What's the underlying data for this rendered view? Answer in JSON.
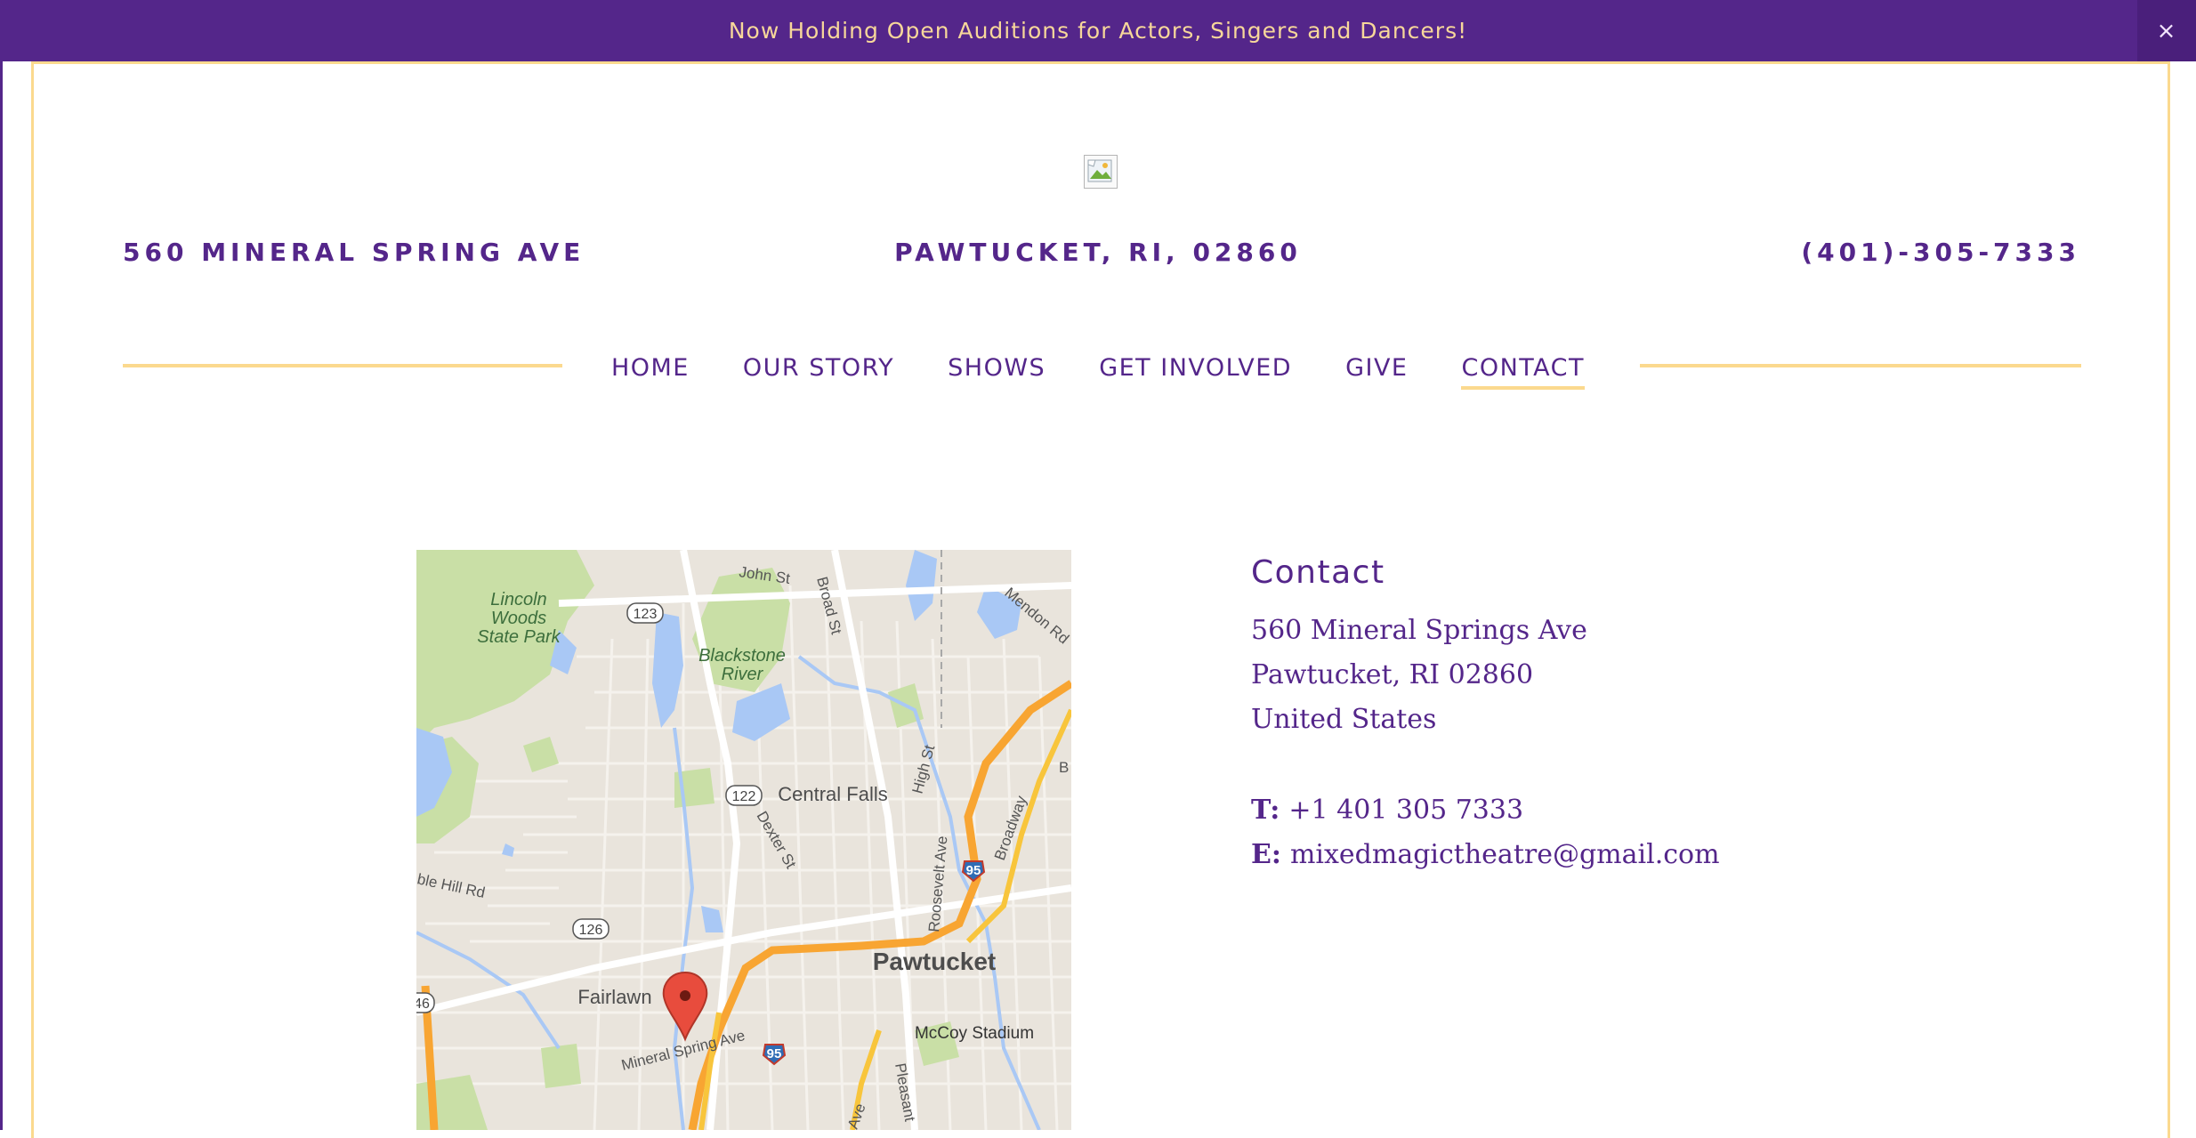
{
  "announcement": {
    "text": "Now Holding Open Auditions for Actors, Singers and Dancers!",
    "close_glyph": "×"
  },
  "header": {
    "address_street": "560 MINERAL SPRING AVE",
    "address_city": "PAWTUCKET, RI, 02860",
    "phone": "(401)-305-7333"
  },
  "nav": {
    "items": [
      {
        "label": "HOME"
      },
      {
        "label": "OUR STORY"
      },
      {
        "label": "SHOWS"
      },
      {
        "label": "GET INVOLVED"
      },
      {
        "label": "GIVE"
      },
      {
        "label": "CONTACT"
      }
    ],
    "active": "CONTACT"
  },
  "map": {
    "labels": {
      "lincoln1": "Lincoln",
      "lincoln2": "Woods",
      "lincoln3": "State Park",
      "blackstone1": "Blackstone",
      "blackstone2": "River",
      "central_falls": "Central Falls",
      "pawtucket": "Pawtucket",
      "fairlawn": "Fairlawn",
      "mccoy": "McCoy Stadium",
      "mineral": "Mineral Spring Ave",
      "john": "John St",
      "broad": "Broad St",
      "mendon": "Mendon Rd",
      "high": "High St",
      "broadway": "Broadway",
      "dexter": "Dexter St",
      "roosevelt": "Roosevelt Ave",
      "marble": "ble Hill Rd",
      "pleasant": "Pleasant",
      "ave": "Ave",
      "b": "B",
      "r123": "123",
      "r122": "122",
      "r126": "126",
      "r146": "46",
      "i95a": "95",
      "i95b": "95"
    }
  },
  "contact": {
    "title": "Contact",
    "address": [
      "560 Mineral Springs Ave",
      "Pawtucket, RI 02860",
      "United States"
    ],
    "phone_label": "T:",
    "phone": "+1 401 305 7333",
    "email_label": "E:",
    "email": "mixedmagictheatre@gmail.com"
  },
  "colors": {
    "brand_purple": "#54268a",
    "accent_gold": "#fbd98e"
  }
}
